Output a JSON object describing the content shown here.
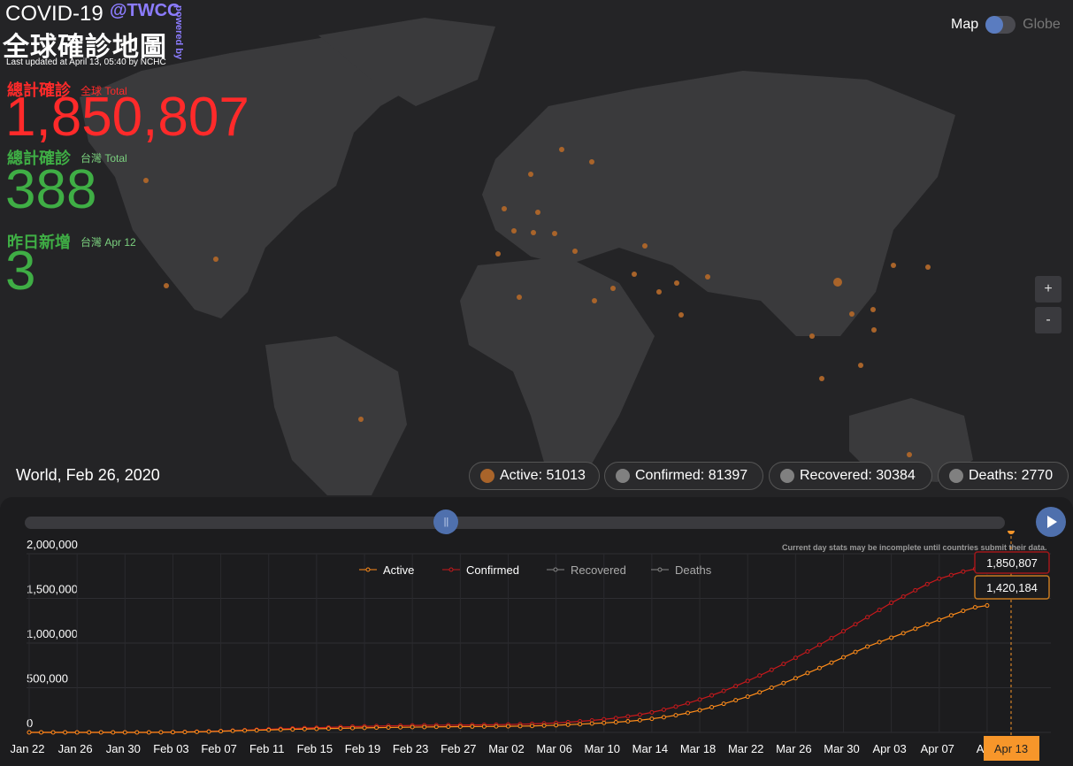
{
  "header": {
    "app_title": "COVID-19",
    "brand": "@TWCC",
    "powered": "powered by",
    "subtitle": "全球確診地圖",
    "last_updated": "Last updated at April 13, 05:40 by NCHC"
  },
  "stats": {
    "global": {
      "label": "總計確診",
      "sub": "全球 Total",
      "value": "1,850,807"
    },
    "taiwan": {
      "label": "總計確診",
      "sub": "台灣 Total",
      "value": "388"
    },
    "yesterday": {
      "label": "昨日新增",
      "sub": "台灣 Apr 12",
      "value": "3"
    }
  },
  "view_toggle": {
    "map_label": "Map",
    "globe_label": "Globe",
    "selected": "Map"
  },
  "zoom": {
    "in_label": "+",
    "out_label": "-"
  },
  "selection": {
    "label": "World, Feb 26, 2020",
    "pills": [
      {
        "label": "Active: 51013",
        "color": "#a9642a"
      },
      {
        "label": "Confirmed: 81397",
        "color": "#808080"
      },
      {
        "label": "Recovered: 30384",
        "color": "#808080"
      },
      {
        "label": "Deaths: 2770",
        "color": "#808080"
      }
    ]
  },
  "timeline": {
    "knob_label": "||",
    "progress": 0.43,
    "note": "Current day stats may be incomplete until countries submit their data."
  },
  "colors": {
    "active": "#ff8c1a",
    "confirmed": "#c8191c",
    "recovered": "#888888",
    "deaths": "#888888",
    "highlight": "#f7962a"
  },
  "chart_data": {
    "type": "line",
    "ylim": [
      0,
      2000000
    ],
    "y_ticks": [
      "2,000,000",
      "1,500,000",
      "1,000,000",
      "500,000",
      "0"
    ],
    "y_tick_values": [
      2000000,
      1500000,
      1000000,
      500000,
      0
    ],
    "x_ticks": [
      "Jan 22",
      "Jan 26",
      "Jan 30",
      "Feb 03",
      "Feb 07",
      "Feb 11",
      "Feb 15",
      "Feb 19",
      "Feb 23",
      "Feb 27",
      "Mar 02",
      "Mar 06",
      "Mar 10",
      "Mar 14",
      "Mar 18",
      "Mar 22",
      "Mar 26",
      "Mar 30",
      "Apr 03",
      "Apr 07",
      "Apr"
    ],
    "x_start": "Jan 22",
    "x_end": "Apr 13",
    "series": [
      {
        "name": "Active",
        "values": [
          0,
          0,
          0,
          0,
          0,
          0,
          0,
          0,
          0,
          0,
          0,
          1000,
          2000,
          4000,
          6000,
          9000,
          13000,
          17000,
          21000,
          24000,
          27000,
          31000,
          34000,
          37000,
          40000,
          43000,
          45000,
          48000,
          51000,
          53000,
          55000,
          57000,
          59000,
          60000,
          62000,
          63000,
          64000,
          65000,
          66000,
          67000,
          68000,
          70000,
          72000,
          76000,
          80000,
          86000,
          92000,
          99000,
          106000,
          114000,
          124000,
          136000,
          152000,
          170000,
          192000,
          218000,
          248000,
          282000,
          320000,
          360000,
          400000,
          448000,
          500000,
          552000,
          606000,
          664000,
          720000,
          780000,
          840000,
          900000,
          960000,
          1010000,
          1060000,
          1110000,
          1160000,
          1210000,
          1260000,
          1310000,
          1360000,
          1400000,
          1420184
        ]
      },
      {
        "name": "Confirmed",
        "values": [
          0,
          0,
          0,
          0,
          0,
          0,
          0,
          0,
          0,
          0,
          0,
          1000,
          3000,
          5000,
          8000,
          11000,
          15000,
          20000,
          25000,
          30000,
          35000,
          40000,
          44000,
          48000,
          52000,
          56000,
          60000,
          64000,
          67000,
          70000,
          73000,
          75000,
          77000,
          79000,
          80000,
          81000,
          82000,
          83000,
          84000,
          86000,
          88000,
          91000,
          95000,
          100000,
          106000,
          114000,
          124000,
          134000,
          146000,
          160000,
          178000,
          198000,
          224000,
          254000,
          288000,
          326000,
          368000,
          414000,
          464000,
          518000,
          576000,
          636000,
          700000,
          766000,
          834000,
          906000,
          980000,
          1056000,
          1132000,
          1210000,
          1290000,
          1370000,
          1450000,
          1520000,
          1590000,
          1660000,
          1720000,
          1760000,
          1800000,
          1830000,
          1850807
        ]
      },
      {
        "name": "Recovered",
        "values": []
      },
      {
        "name": "Deaths",
        "values": []
      }
    ],
    "highlight": {
      "x_label": "Apr 13",
      "confirmed_label": "1,850,807",
      "active_label": "1,420,184"
    }
  }
}
